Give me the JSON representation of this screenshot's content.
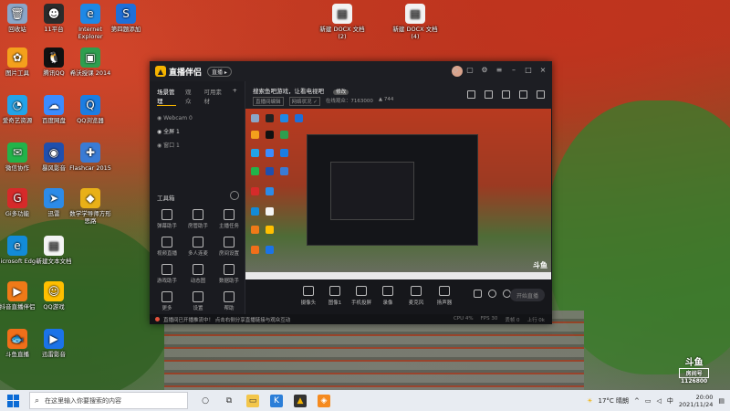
{
  "desktop": {
    "icons": [
      {
        "label": "回收站",
        "icon": "recycle-bin-icon",
        "color": "#8aa6c8",
        "glyph": "🗑"
      },
      {
        "label": "11平台",
        "icon": "platform-11-icon",
        "color": "#2b2b2b",
        "glyph": "☻"
      },
      {
        "label": "Internet Explorer",
        "icon": "ie-icon",
        "color": "#1e88e5",
        "glyph": "e"
      },
      {
        "label": "第四题添加",
        "icon": "app-s-icon",
        "color": "#1e6fd9",
        "glyph": "S"
      },
      {
        "label": "新建 DOCX 文档(2)",
        "icon": "document-icon",
        "color": "#f2f2f2",
        "glyph": "▤"
      },
      {
        "label": "新建 DOCX 文档(4)",
        "icon": "document-icon",
        "color": "#f2f2f2",
        "glyph": "▤"
      },
      {
        "label": "图片工具",
        "icon": "pinwheel-icon",
        "color": "#f4a01c",
        "glyph": "✿"
      },
      {
        "label": "腾讯QQ",
        "icon": "qq-icon",
        "color": "#111111",
        "glyph": "🐧"
      },
      {
        "label": "希沃授课 2014",
        "icon": "green-board-icon",
        "color": "#2e9e4f",
        "glyph": "▣"
      },
      {
        "label": "爱奇艺资源",
        "icon": "iqiyi-icon",
        "color": "#23a3e8",
        "glyph": "◔"
      },
      {
        "label": "百度网盘",
        "icon": "baidu-netdisk-icon",
        "color": "#3b8cff",
        "glyph": "☁"
      },
      {
        "label": "QQ浏览器",
        "icon": "qq-browser-icon",
        "color": "#1b7de2",
        "glyph": "Q"
      },
      {
        "label": "微信协作",
        "icon": "wechat-icon",
        "color": "#22b34a",
        "glyph": "✉"
      },
      {
        "label": "暴风影音",
        "icon": "storm-player-icon",
        "color": "#1f4fae",
        "glyph": "◉"
      },
      {
        "label": "Flashcar 2015",
        "icon": "flash-icon",
        "color": "#3a7bd5",
        "glyph": "✚"
      },
      {
        "label": "Gi多功能",
        "icon": "g-icon",
        "color": "#d62a2a",
        "glyph": "G"
      },
      {
        "label": "迅雷",
        "icon": "xunlei-icon",
        "color": "#2c8be8",
        "glyph": "➤"
      },
      {
        "label": "数学学导师方形思路",
        "icon": "shield-app-icon",
        "color": "#e8b018",
        "glyph": "◆"
      },
      {
        "label": "Microsoft Edge",
        "icon": "edge-icon",
        "color": "#138bd8",
        "glyph": "e"
      },
      {
        "label": "新建文本文档",
        "icon": "text-file-icon",
        "color": "#f4f4f4",
        "glyph": "▤"
      },
      {
        "label": "抖音直播伴侣",
        "icon": "douyu-live-icon",
        "color": "#ef7a18",
        "glyph": "▶"
      },
      {
        "label": "QQ游戏",
        "icon": "qq-game-icon",
        "color": "#ffbf00",
        "glyph": "☺"
      },
      {
        "label": "斗鱼直播",
        "icon": "douyu-icon",
        "color": "#f06f1a",
        "glyph": "🐟"
      },
      {
        "label": "迅雷影音",
        "icon": "xunlei-player-icon",
        "color": "#1b73e8",
        "glyph": "▶"
      }
    ]
  },
  "app": {
    "name": "直播伴侣",
    "badge": "直播 ▸",
    "sidebar_tabs": [
      "场景管理",
      "观众",
      "可用素材"
    ],
    "scenes": [
      "◉ Webcam 0",
      "◉ 全屏 1",
      "◉ 窗口 1"
    ],
    "tools_title": "工具箱",
    "tools": [
      {
        "label": "弹幕助手"
      },
      {
        "label": "房管助手"
      },
      {
        "label": "主播任务"
      },
      {
        "label": "视频直播"
      },
      {
        "label": "多人连麦"
      },
      {
        "label": "房间设置"
      },
      {
        "label": "游戏助手"
      },
      {
        "label": "动态图"
      },
      {
        "label": "数据助手"
      },
      {
        "label": "更多"
      },
      {
        "label": "设置"
      },
      {
        "label": "帮助"
      }
    ],
    "header": {
      "title": "搜索鱼吧游戏，让看电视吧",
      "tag": "修改",
      "meta": [
        "直播间编辑",
        "网络状况 ✓",
        "在线观众：7163000",
        "▲ 744"
      ]
    },
    "controls": [
      {
        "label": "摄像头"
      },
      {
        "label": "图像1"
      },
      {
        "label": "手机投屏"
      },
      {
        "label": "录像"
      },
      {
        "label": "麦克风"
      },
      {
        "label": "扬声器"
      }
    ],
    "go_live": "开始直播",
    "status_text": "直播间已开播推流中！ 点击右侧分享直播链接与观众互动",
    "status_right": [
      "CPU 4%",
      "FPS 30",
      "丢帧 0",
      "上行 0k"
    ]
  },
  "watermark": {
    "brand": "斗鱼",
    "sub": "房间号",
    "num": "1126800"
  },
  "taskbar": {
    "search_placeholder": "在这里输入你要搜索的内容",
    "weather": "17°C  晴朗",
    "time": "20:00",
    "date": "2021/11/24"
  }
}
